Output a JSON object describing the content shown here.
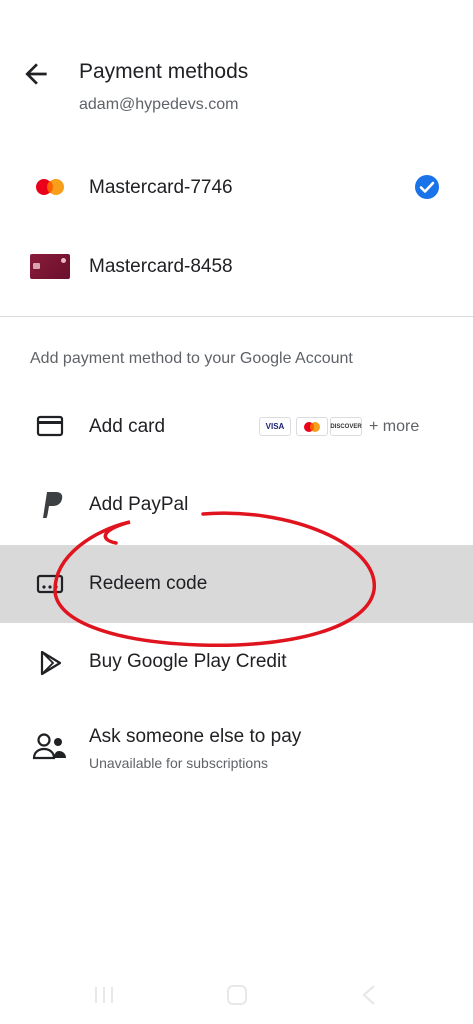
{
  "header": {
    "title": "Payment methods",
    "account_email": "adam@hypedevs.com"
  },
  "saved_methods": [
    {
      "label": "Mastercard-7746",
      "selected": true
    },
    {
      "label": "Mastercard-8458",
      "selected": false
    }
  ],
  "add_section": {
    "heading": "Add payment method to your Google Account",
    "items": [
      {
        "label": "Add card",
        "icon": "credit-card-icon"
      },
      {
        "label": "Add PayPal",
        "icon": "paypal-icon"
      },
      {
        "label": "Redeem code",
        "icon": "redeem-code-icon",
        "highlighted": true
      },
      {
        "label": "Buy Google Play Credit",
        "icon": "play-icon"
      },
      {
        "label": "Ask someone else to pay",
        "icon": "family-icon",
        "subtitle": "Unavailable for subscriptions"
      }
    ],
    "card_brands": [
      "VISA",
      "mastercard",
      "DISCOVER"
    ],
    "more_label": "+ more"
  },
  "colors": {
    "accent_blue": "#1a73e8",
    "annotation_red": "#e0141e",
    "highlight_gray": "#d9d9d9"
  },
  "system_nav": [
    "recent-apps-icon",
    "home-icon",
    "back-nav-icon"
  ]
}
